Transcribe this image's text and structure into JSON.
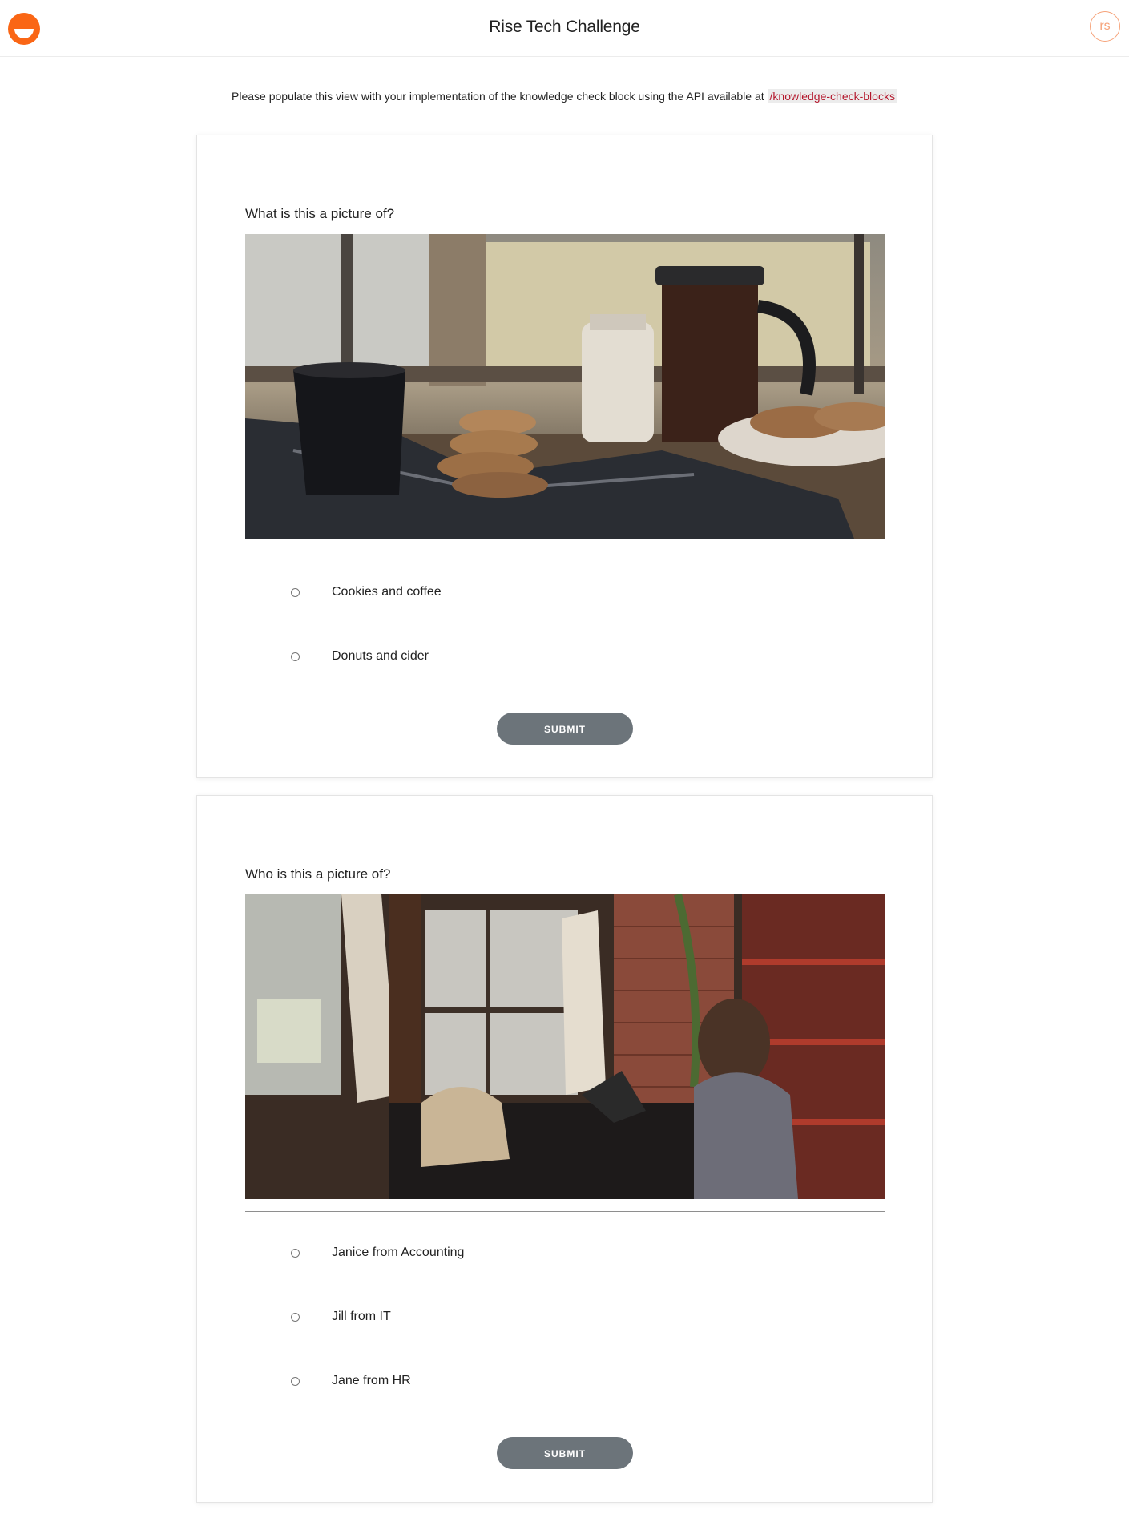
{
  "header": {
    "title": "Rise Tech Challenge",
    "avatar_initials": "rs",
    "brand_color": "#fa6615"
  },
  "intro": {
    "text": "Please populate this view with your implementation of the knowledge check block using the API available at",
    "endpoint": "/knowledge-check-blocks"
  },
  "blocks": [
    {
      "question": "What is this a picture of?",
      "answers": [
        "Cookies and coffee",
        "Donuts and cider"
      ],
      "submit_label": "SUBMIT",
      "image": "cookies-coffee-photo"
    },
    {
      "question": "Who is this a picture of?",
      "answers": [
        "Janice from Accounting",
        "Jill from IT",
        "Jane from HR"
      ],
      "submit_label": "SUBMIT",
      "image": "cafe-laptop-photo"
    }
  ]
}
